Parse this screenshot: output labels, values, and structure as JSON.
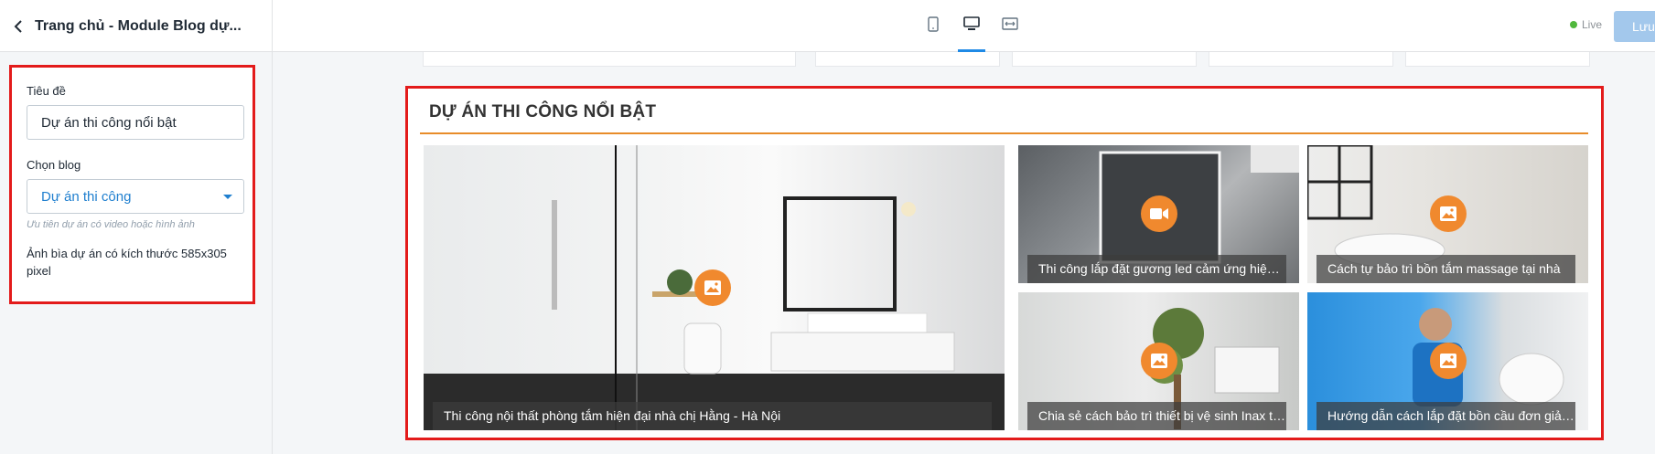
{
  "sidebar": {
    "title": "Trang chủ - Module Blog dự...",
    "fields": {
      "title_label": "Tiêu đề",
      "title_value": "Dự án thi công nổi bật",
      "blog_label": "Chọn blog",
      "blog_selected": "Dự án thi công",
      "blog_help": "Ưu tiên dự án có video hoặc hình ảnh",
      "cover_note": "Ảnh bìa dự án có kích thước 585x305 pixel"
    }
  },
  "toolbar": {
    "devices": [
      "mobile-icon",
      "desktop-icon",
      "fullwidth-icon"
    ],
    "active_device": "desktop-icon",
    "live_label": "Live",
    "save_label": "Lưu"
  },
  "module": {
    "heading": "DỰ ÁN THI CÔNG NỔI BẬT",
    "accent_color": "#e88c2a",
    "projects": [
      {
        "caption": "Thi công nội thất phòng tắm hiện đại nhà chị Hằng - Hà Nội",
        "media": "image-icon"
      },
      {
        "caption": "Thi công lắp đặt gương led cảm ứng hiện đại",
        "media": "video-icon"
      },
      {
        "caption": "Cách tự bảo trì bồn tắm massage tại nhà",
        "media": "image-icon"
      },
      {
        "caption": "Chia sẻ cách bảo trì thiết bị vệ sinh Inax tốt nhất",
        "media": "image-icon"
      },
      {
        "caption": "Hướng dẫn cách lắp đặt bồn cầu đơn giản tại nhà",
        "media": "image-icon"
      }
    ]
  },
  "colors": {
    "highlight_border": "#e31b1b",
    "media_badge": "#f0892e",
    "link_blue": "#1f7fcf"
  }
}
